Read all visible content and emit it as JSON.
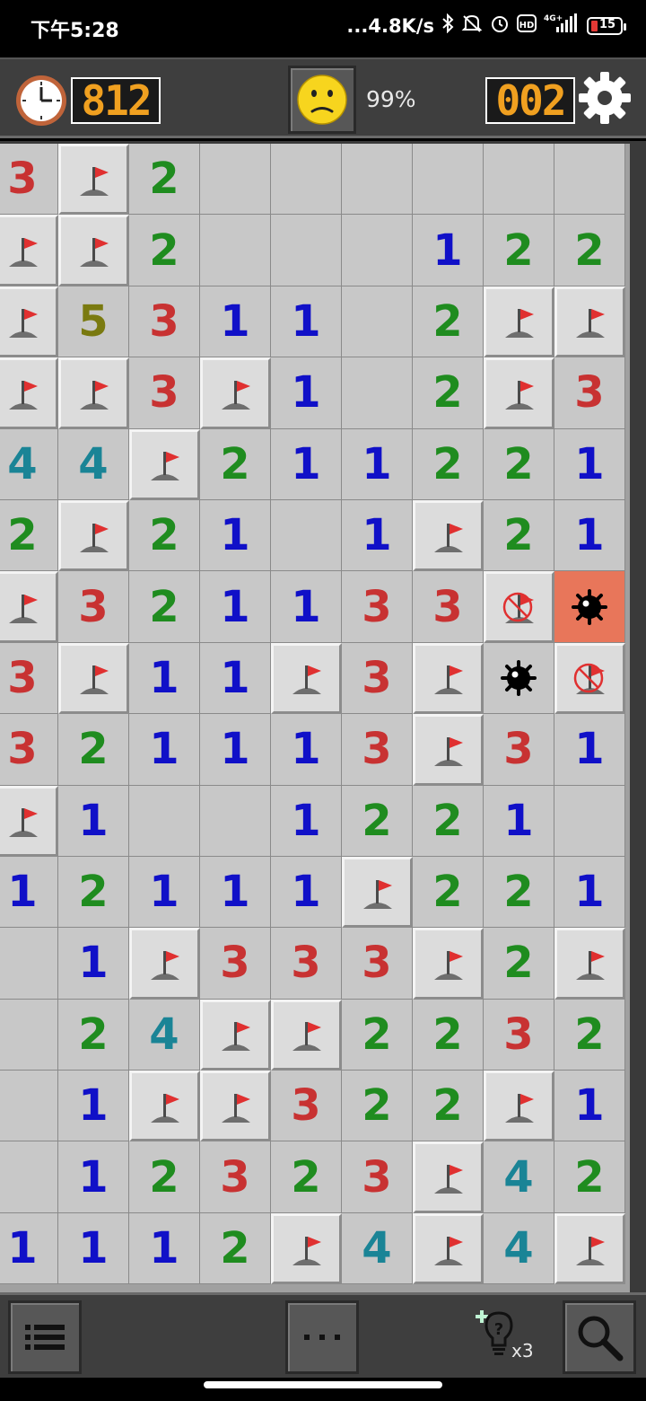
{
  "status_bar": {
    "time": "下午5:28",
    "network_speed": "...4.8K/s",
    "icons": [
      "bluetooth-icon",
      "mute-icon",
      "alarm-icon",
      "hd-icon",
      "4g-signal-icon",
      "battery-icon"
    ],
    "battery_level": "15",
    "hd_label": "HD",
    "net_label": "4G+"
  },
  "header": {
    "timer": "812",
    "mines_remaining": "002",
    "progress": "99%",
    "face_state": "frown"
  },
  "board": {
    "columns": 9,
    "rows_visible": 16,
    "cells": [
      [
        "3",
        "F",
        "2",
        "",
        "",
        "",
        "",
        "",
        ""
      ],
      [
        "F",
        "F",
        "2",
        "",
        "",
        "",
        "1",
        "2",
        "2"
      ],
      [
        "F",
        "5",
        "3",
        "1",
        "1",
        "",
        "2",
        "F",
        "F"
      ],
      [
        "F",
        "F",
        "3",
        "F",
        "1",
        "",
        "2",
        "F",
        "3"
      ],
      [
        "4",
        "4",
        "F",
        "2",
        "1",
        "1",
        "2",
        "2",
        "1"
      ],
      [
        "2",
        "F",
        "2",
        "1",
        "",
        "1",
        "F",
        "2",
        "1"
      ],
      [
        "F",
        "3",
        "2",
        "1",
        "1",
        "3",
        "3",
        "X",
        "B"
      ],
      [
        "3",
        "F",
        "1",
        "1",
        "F",
        "3",
        "F",
        "M",
        "X"
      ],
      [
        "3",
        "2",
        "1",
        "1",
        "1",
        "3",
        "F",
        "3",
        "1"
      ],
      [
        "F",
        "1",
        "",
        "",
        "1",
        "2",
        "2",
        "1",
        ""
      ],
      [
        "1",
        "2",
        "1",
        "1",
        "1",
        "F",
        "2",
        "2",
        "1"
      ],
      [
        "",
        "1",
        "F",
        "3",
        "3",
        "3",
        "F",
        "2",
        "F"
      ],
      [
        "",
        "2",
        "4",
        "F",
        "F",
        "2",
        "2",
        "3",
        "2"
      ],
      [
        "",
        "1",
        "F",
        "F",
        "3",
        "2",
        "2",
        "F",
        "1"
      ],
      [
        "",
        "1",
        "2",
        "3",
        "2",
        "3",
        "F",
        "4",
        "2"
      ],
      [
        "1",
        "1",
        "1",
        "2",
        "F",
        "4",
        "F",
        "4",
        "F"
      ]
    ],
    "legend": {
      "F": "flag",
      "X": "wrong-flag",
      "B": "exploded-mine",
      "M": "mine"
    }
  },
  "footer": {
    "hints_remaining": "x3"
  },
  "colors": {
    "timer_digits": "#f0a020",
    "exploded_bg": "#e8765a",
    "n1": "#1010c8",
    "n2": "#1f8c1f",
    "n3": "#c83232",
    "n4": "#1a8496",
    "n5": "#7a7a10"
  }
}
